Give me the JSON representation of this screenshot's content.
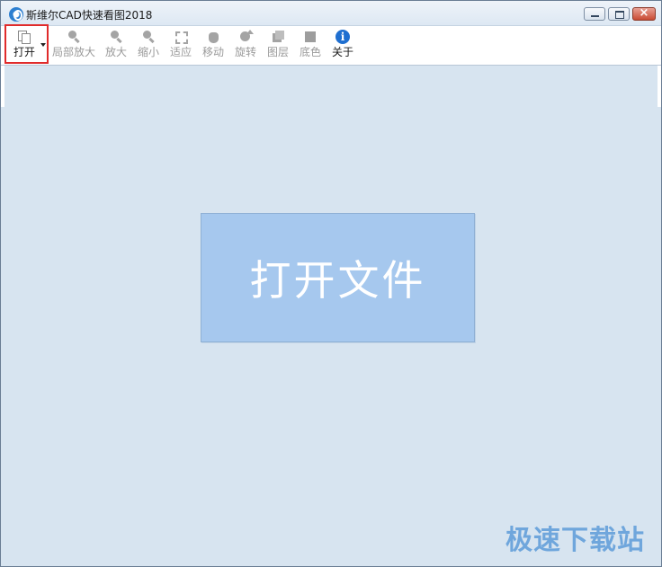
{
  "window": {
    "title": "斯维尔CAD快速看图2018",
    "controls": {
      "minimize": "minimize",
      "maximize": "maximize",
      "close": "×"
    }
  },
  "toolbar": {
    "items": [
      {
        "label": "打开",
        "icon": "open-file-icon",
        "enabled": true
      },
      {
        "label": "局部放大",
        "icon": "zoom-window-icon",
        "enabled": false
      },
      {
        "label": "放大",
        "icon": "zoom-in-icon",
        "enabled": false
      },
      {
        "label": "缩小",
        "icon": "zoom-out-icon",
        "enabled": false
      },
      {
        "label": "适应",
        "icon": "fit-icon",
        "enabled": false
      },
      {
        "label": "移动",
        "icon": "hand-icon",
        "enabled": false
      },
      {
        "label": "旋转",
        "icon": "rotate-icon",
        "enabled": false
      },
      {
        "label": "图层",
        "icon": "layers-icon",
        "enabled": false
      },
      {
        "label": "底色",
        "icon": "background-color-icon",
        "enabled": false
      },
      {
        "label": "关于",
        "icon": "info-icon",
        "enabled": true
      }
    ]
  },
  "main": {
    "open_file_button": "打开文件"
  },
  "watermark": "极速下载站",
  "colors": {
    "workspace": "#d7e4f0",
    "open_button": "#a6c8ee",
    "highlight": "#e02b2b",
    "watermark": "#6fa6dc"
  }
}
